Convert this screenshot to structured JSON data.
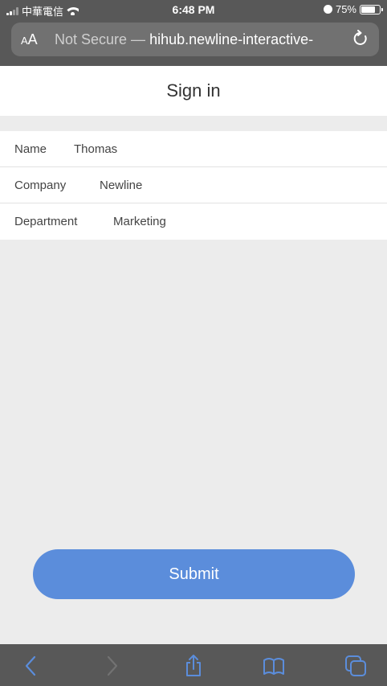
{
  "status_bar": {
    "carrier": "中華電信",
    "time": "6:48 PM",
    "battery": "75%",
    "battery_level": 0.75
  },
  "address_bar": {
    "aa_label_small": "A",
    "aa_label_large": "A",
    "prefix": "Not Secure —",
    "host": "hihub.newline-interactive-"
  },
  "page": {
    "title": "Sign in"
  },
  "form": {
    "fields": [
      {
        "label": "Name",
        "value": "Thomas"
      },
      {
        "label": "Company",
        "value": "Newline"
      },
      {
        "label": "Department",
        "value": "Marketing"
      }
    ]
  },
  "submit_label": "Submit",
  "toolbar": {
    "icons": [
      "back-icon",
      "forward-icon",
      "share-icon",
      "bookmarks-icon",
      "tabs-icon"
    ]
  }
}
